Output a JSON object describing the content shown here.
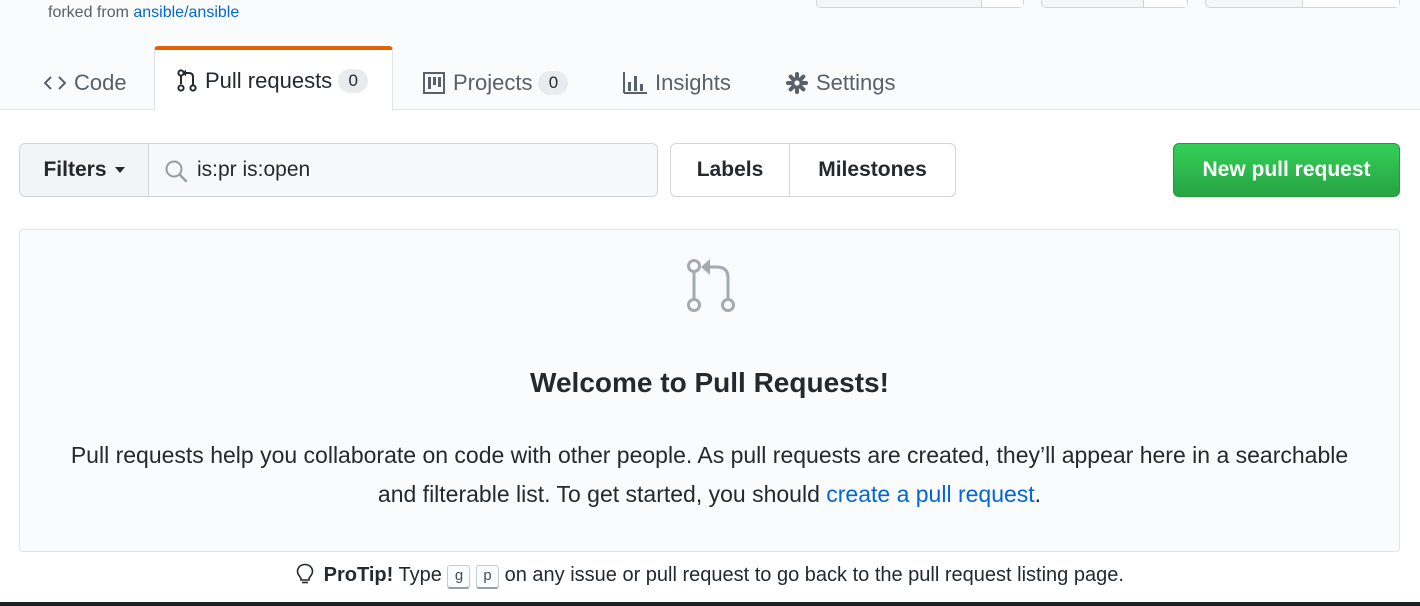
{
  "repo": {
    "forked_label": "forked from",
    "forked_link": "ansible/ansible"
  },
  "tabs": [
    {
      "label": "Code",
      "icon": "code-icon"
    },
    {
      "label": "Pull requests",
      "icon": "pull-request-icon",
      "count": "0",
      "selected": true
    },
    {
      "label": "Projects",
      "icon": "project-icon",
      "count": "0"
    },
    {
      "label": "Insights",
      "icon": "graph-icon"
    },
    {
      "label": "Settings",
      "icon": "gear-icon"
    }
  ],
  "toolbar": {
    "filters_label": "Filters",
    "search_value": "is:pr is:open",
    "search_icon": "search-icon",
    "labels_label": "Labels",
    "milestones_label": "Milestones",
    "new_pr_label": "New pull request"
  },
  "blankslate": {
    "icon": "pull-request-icon",
    "title": "Welcome to Pull Requests!",
    "text_before_link": "Pull requests help you collaborate on code with other people. As pull requests are created, they’ll appear here in a searchable and filterable list. To get started, you should ",
    "link": "create a pull request",
    "text_after_link": "."
  },
  "protip": {
    "icon": "light-bulb-icon",
    "label": "ProTip!",
    "text_before_keys": "Type",
    "key1": "g",
    "key2": "p",
    "text_after_keys": "on any issue or pull request to go back to the pull request listing page."
  },
  "colors": {
    "accent_tab": "#e36209",
    "link": "#0366d6",
    "primary_button": "#28a745"
  }
}
